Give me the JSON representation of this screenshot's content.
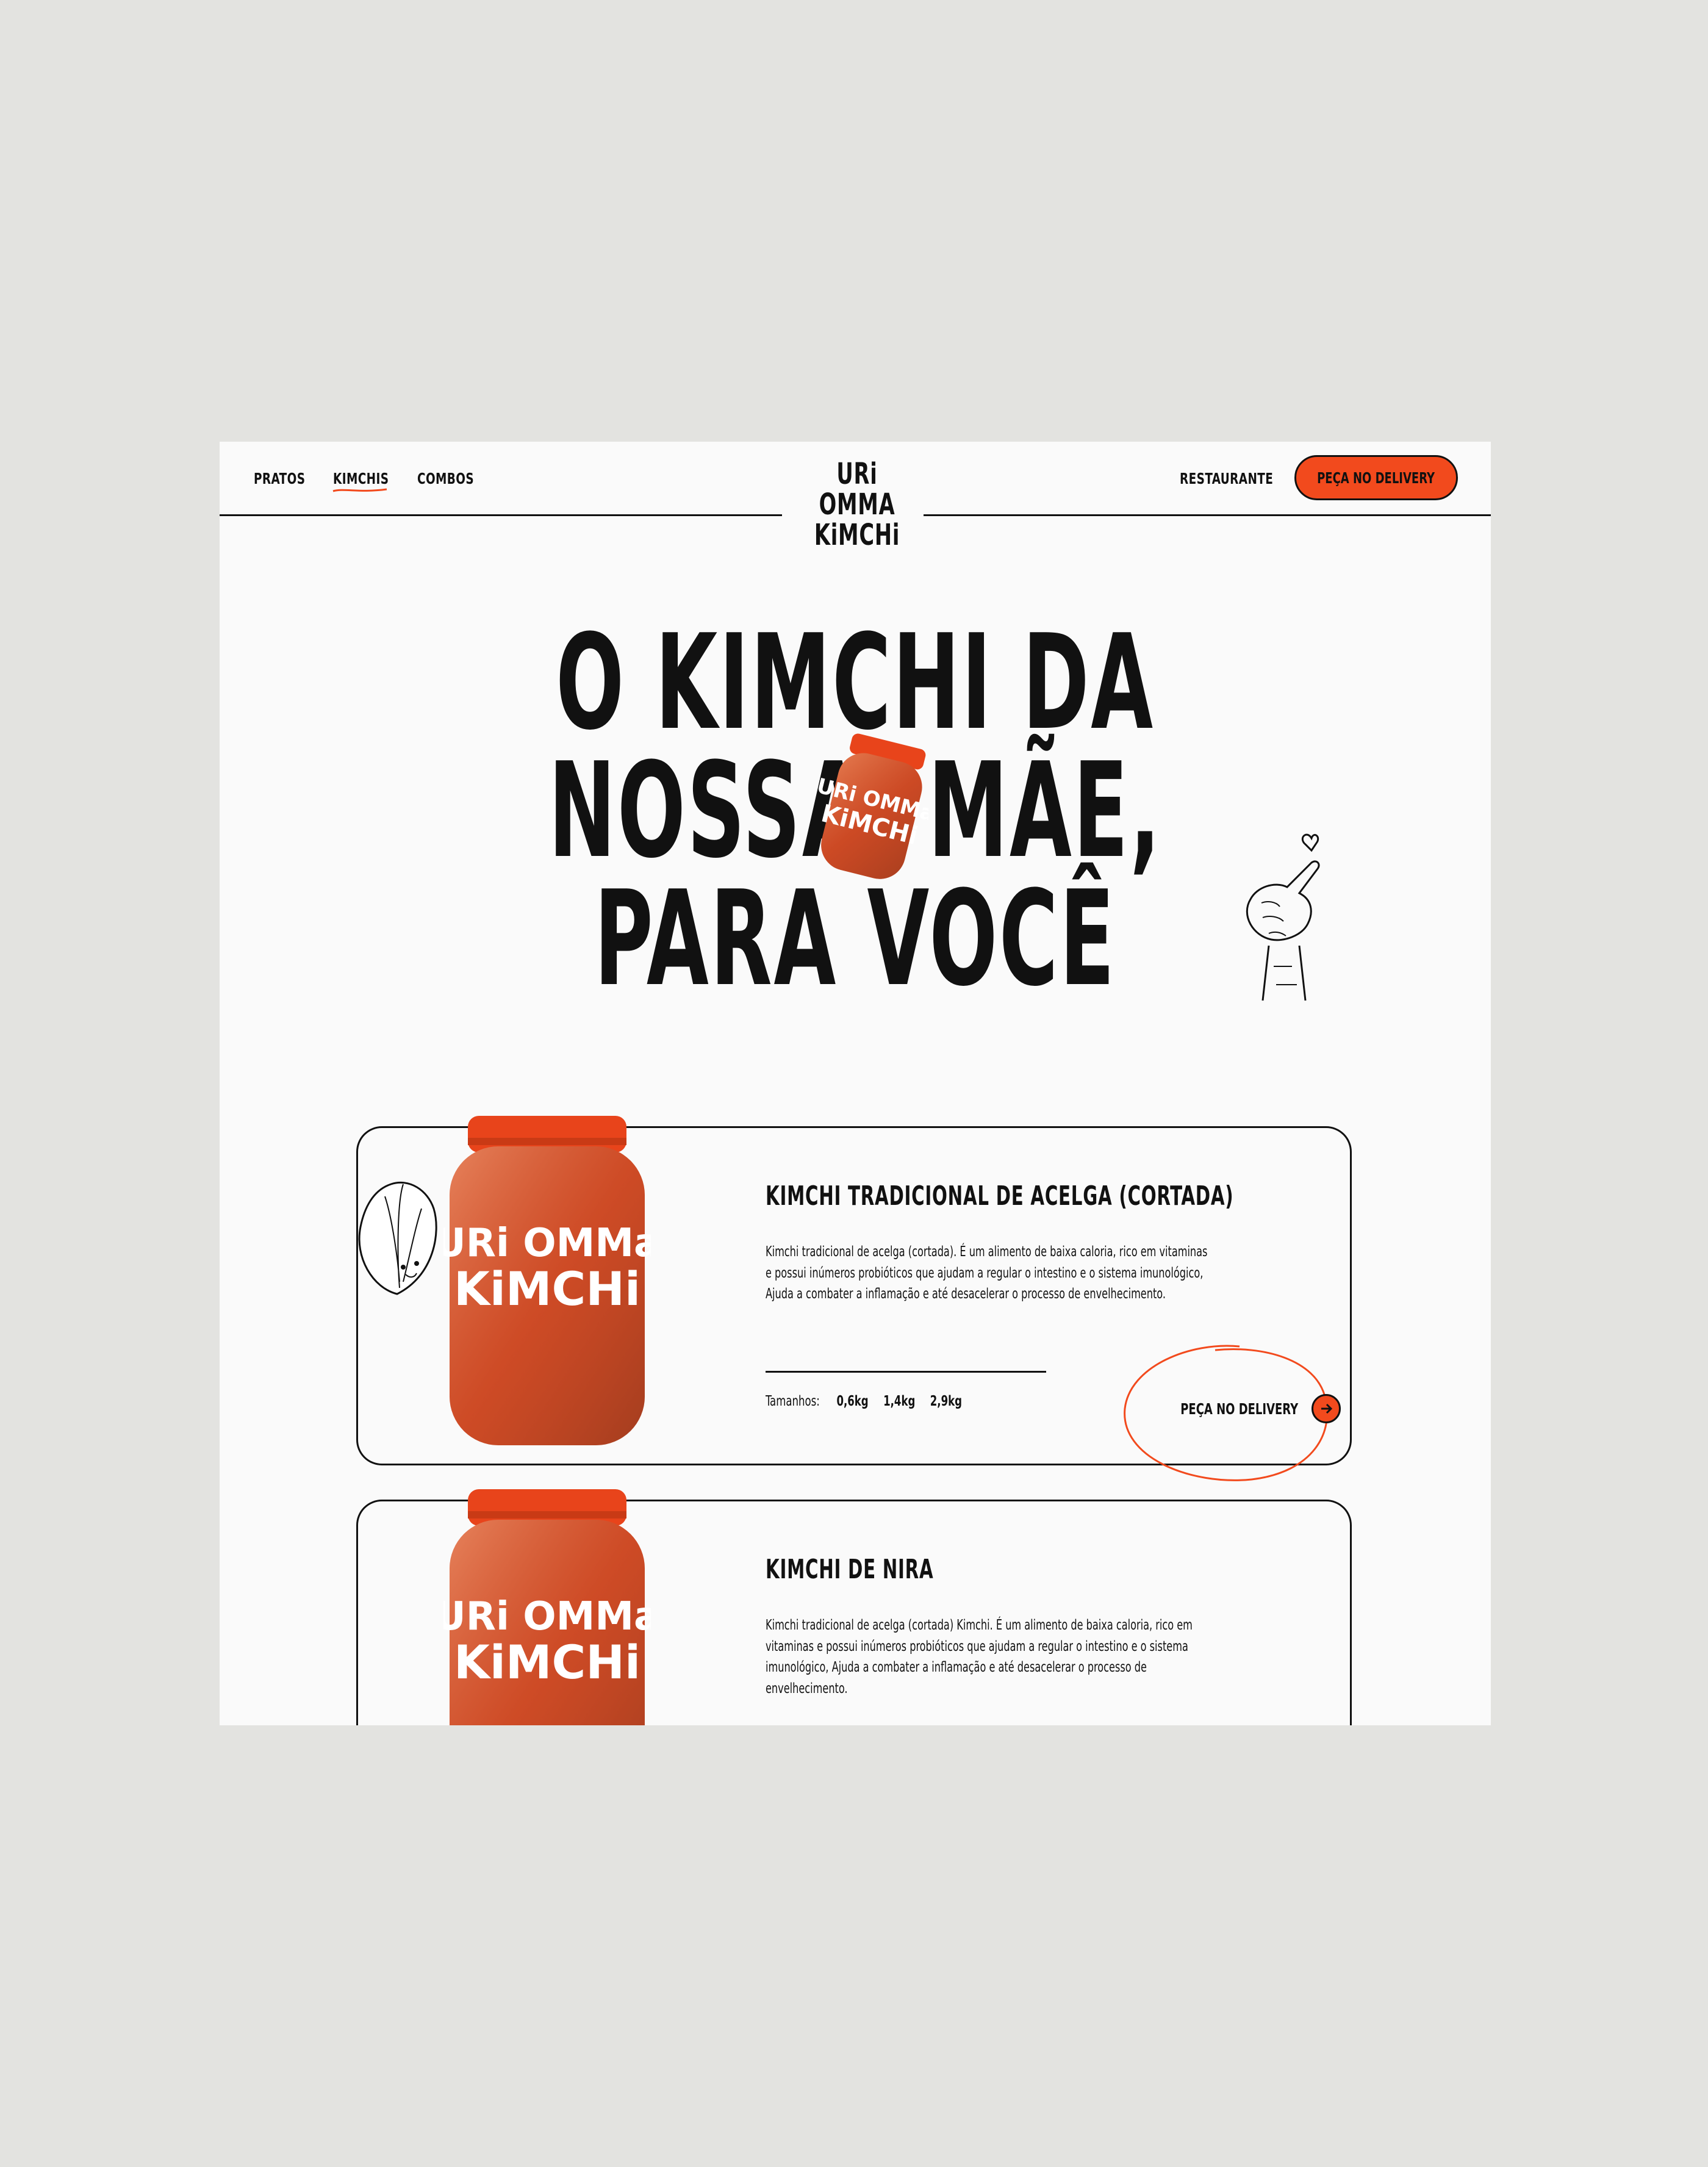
{
  "nav": {
    "left": [
      "PRATOS",
      "KIMCHIS",
      "COMBOS"
    ],
    "active": "KIMCHIS",
    "logo_line1": "URi OMMA",
    "logo_line2": "KiMCHi",
    "restaurant": "RESTAURANTE",
    "cta": "PEÇA NO DELIVERY"
  },
  "hero": {
    "line1": "O KIMCHI DA",
    "line2a": "NOSSA",
    "line2b": "MÃE,",
    "line3": "PARA VOCÊ"
  },
  "jar_label": {
    "l1": "URi OMMa",
    "l2": "KiMCHi"
  },
  "products": [
    {
      "title": "KIMCHI TRADICIONAL DE ACELGA (CORTADA)",
      "description": "Kimchi tradicional de acelga (cortada). É um alimento de baixa caloria, rico em vitaminas e possui inúmeros probióticos que ajudam a regular o intestino e o sistema imunológico, Ajuda a combater a inflamação e até desacelerar o processo de envelhecimento.",
      "sizes_label": "Tamanhos:",
      "sizes": [
        "0,6kg",
        "1,4kg",
        "2,9kg"
      ],
      "cta": "PEÇA NO DELIVERY"
    },
    {
      "title": "KIMCHI DE NIRA",
      "description": "Kimchi tradicional de acelga (cortada) Kimchi. É um alimento de baixa caloria, rico em vitaminas e possui inúmeros probióticos que ajudam a regular o intestino e o sistema imunológico, Ajuda a combater a inflamação e até desacelerar o processo de envelhecimento."
    }
  ],
  "colors": {
    "accent": "#f24a1d",
    "page_bg": "#fafafa",
    "outer_bg": "#e3e3e0",
    "ink": "#111111"
  }
}
